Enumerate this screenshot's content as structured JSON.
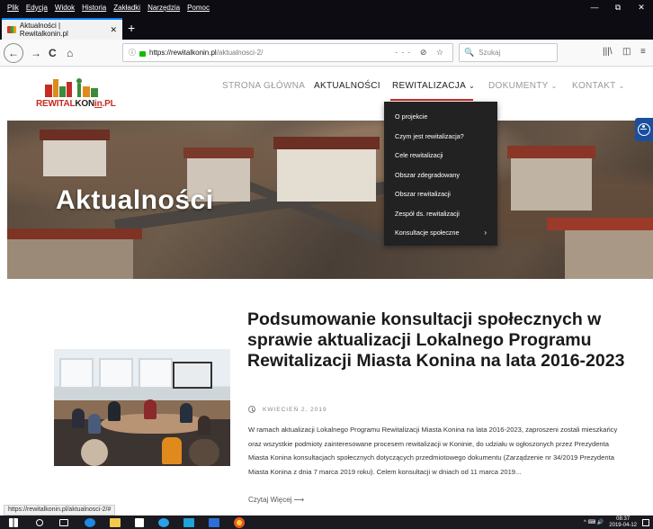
{
  "browser": {
    "menu": [
      "Plik",
      "Edycja",
      "Widok",
      "Historia",
      "Zakładki",
      "Narzędzia",
      "Pomoc"
    ],
    "window_controls": {
      "minimize": "—",
      "restore": "⧉",
      "close": "✕"
    },
    "tab": {
      "title": "Aktualności | Rewitalkonin.pl",
      "close": "✕"
    },
    "new_tab": "+",
    "nav": {
      "back": "←",
      "forward": "→",
      "reload": "C",
      "home": "⌂"
    },
    "url": {
      "info": "ⓘ",
      "host": "https://rewitalkonin.pl",
      "path": "/aktualnosci-2/",
      "actions": "··· ⊘ ☆"
    },
    "search": {
      "icon": "🔍",
      "placeholder": "Szukaj"
    },
    "tools": {
      "library": "|||\\",
      "sidebar": "◫",
      "menu": "≡"
    },
    "status_url": "https://rewitalkonin.pl/aktualnosci-2/#"
  },
  "site": {
    "logo": {
      "part1": "REWITAL",
      "part2": "KON",
      "part3": "in",
      "part4": ".PL"
    },
    "nav": [
      {
        "label": "STRONA GŁÓWNA",
        "caret": ""
      },
      {
        "label": "AKTUALNOŚCI",
        "caret": ""
      },
      {
        "label": "REWITALIZACJA",
        "caret": "⌄"
      },
      {
        "label": "DOKUMENTY",
        "caret": "⌄"
      },
      {
        "label": "KONTAKT",
        "caret": "⌄"
      }
    ],
    "dropdown": [
      {
        "label": "O projekcie",
        "arrow": ""
      },
      {
        "label": "Czym jest rewitalizacja?",
        "arrow": ""
      },
      {
        "label": "Cele rewitalizacji",
        "arrow": ""
      },
      {
        "label": "Obszar zdegradowany",
        "arrow": ""
      },
      {
        "label": "Obszar rewitalizacji",
        "arrow": ""
      },
      {
        "label": "Zespół ds. rewitalizacji",
        "arrow": ""
      },
      {
        "label": "Konsultacje społeczne",
        "arrow": "›"
      }
    ],
    "hero_title": "Aktualności",
    "article": {
      "title": "Podsumowanie konsultacji społecznych w sprawie aktualizacji Lokalnego Programu Rewitalizacji Miasta Konina na lata 2016-2023",
      "date": "KWIECIEŃ 2, 2019",
      "excerpt": "W ramach aktualizacji Lokalnego Programu Rewitalizacji Miasta Konina na lata 2016-2023, zaproszeni zostali mieszkańcy oraz wszystkie podmioty zainteresowane procesem rewitalizacji w Koninie, do udziału w ogłoszonych przez Prezydenta Miasta Konina konsultacjach społecznych dotyczących przedmiotowego dokumentu (Zarządzenie nr 34/2019 Prezydenta Miasta Konina z dnia 7 marca 2019 roku). Celem konsultacji w dniach od 11 marca 2019...",
      "read_more": "Czytaj Więcej ⟶"
    }
  },
  "taskbar": {
    "clock_time": "08:37",
    "clock_date": "2019-04-12",
    "tray": "^ ⌨ 🔊"
  }
}
